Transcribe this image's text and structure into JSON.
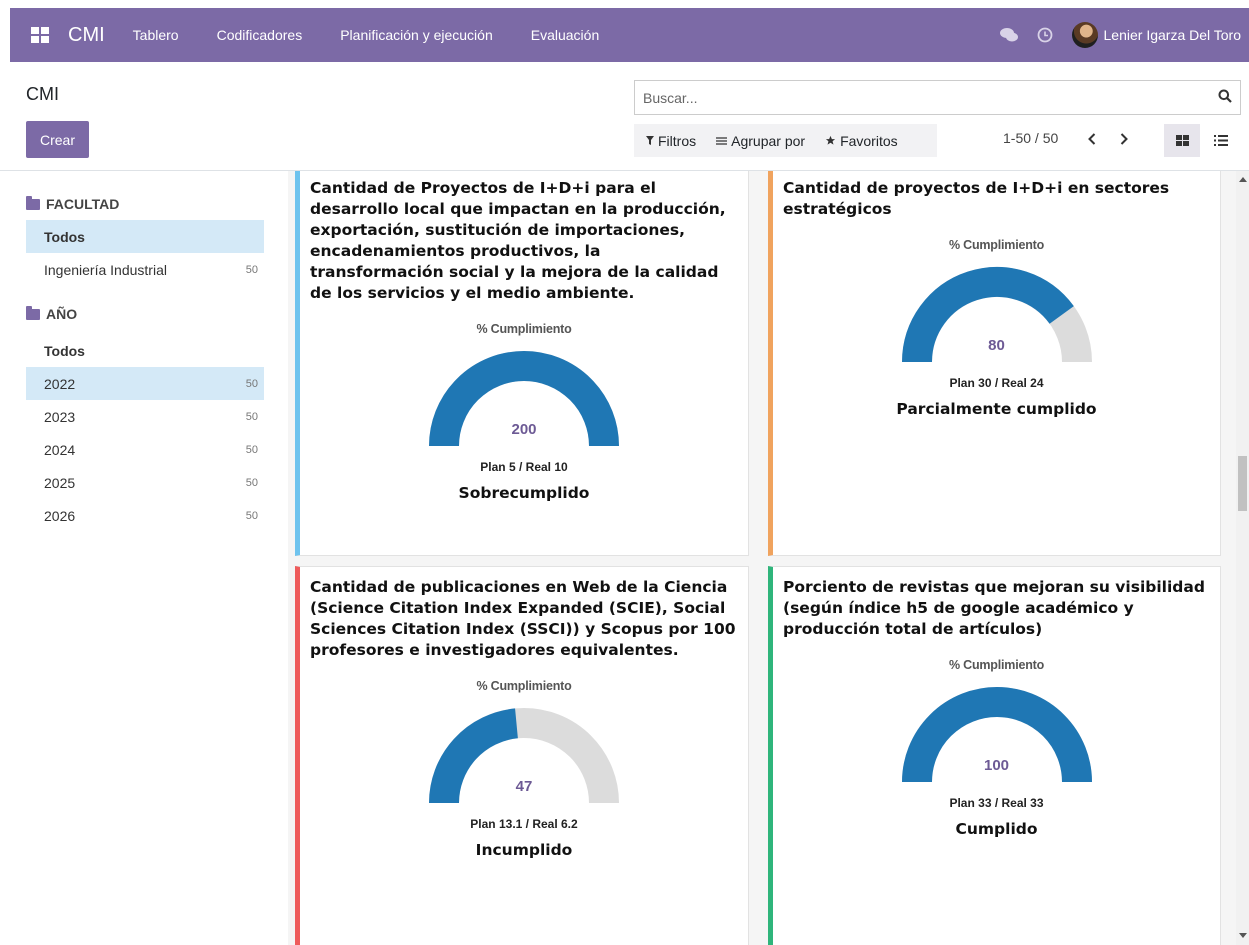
{
  "navbar": {
    "brand": "CMI",
    "menu": [
      "Tablero",
      "Codificadores",
      "Planificación y ejecución",
      "Evaluación"
    ],
    "user_name": "Lenier Igarza Del Toro",
    "color": "#7c6aa6"
  },
  "control_panel": {
    "title": "CMI",
    "create_label": "Crear",
    "search_placeholder": "Buscar...",
    "filters_label": "Filtros",
    "group_by_label": "Agrupar por",
    "favorites_label": "Favoritos",
    "pager": "1-50 / 50"
  },
  "sidebar": {
    "section1": {
      "title": "FACULTAD",
      "items": [
        {
          "label": "Todos",
          "count": ""
        },
        {
          "label": "Ingeniería Industrial",
          "count": "50"
        }
      ]
    },
    "section2": {
      "title": "AÑO",
      "items": [
        {
          "label": "Todos",
          "count": ""
        },
        {
          "label": "2022",
          "count": "50"
        },
        {
          "label": "2023",
          "count": "50"
        },
        {
          "label": "2024",
          "count": "50"
        },
        {
          "label": "2025",
          "count": "50"
        },
        {
          "label": "2026",
          "count": "50"
        }
      ]
    }
  },
  "cards": [
    {
      "title": "Cantidad de Proyectos de I+D+i para el desarrollo local que impactan en la producción, exportación, sustitución de importaciones, encadenamientos productivos, la transformación social y la mejora de la calidad de los servicios y el medio ambiente.",
      "gauge_label": "% Cumplimiento",
      "value": "200",
      "fill_fraction": 1.0,
      "plan_real": "Plan 5 / Real 10",
      "status": "Sobrecumplido",
      "accent": "#6ec3ee"
    },
    {
      "title": "Cantidad de proyectos de I+D+i en sectores estratégicos",
      "gauge_label": "% Cumplimiento",
      "value": "80",
      "fill_fraction": 0.8,
      "plan_real": "Plan 30 / Real 24",
      "status": "Parcialmente cumplido",
      "accent": "#f0a35e"
    },
    {
      "title": "Cantidad de publicaciones en Web de la Ciencia (Science Citation Index Expanded (SCIE), Social Sciences Citation Index (SSCI)) y Scopus por 100 profesores e investigadores equivalentes.",
      "gauge_label": "% Cumplimiento",
      "value": "47",
      "fill_fraction": 0.47,
      "plan_real": "Plan 13.1 / Real 6.2",
      "status": "Incumplido",
      "accent": "#ee5b5b"
    },
    {
      "title": "Porciento de revistas que mejoran su visibilidad (según índice h5 de google académico y producción total de artículos)",
      "gauge_label": "% Cumplimiento",
      "value": "100",
      "fill_fraction": 1.0,
      "plan_real": "Plan 33 / Real 33",
      "status": "Cumplido",
      "accent": "#2fb57b"
    }
  ],
  "gauge_colors": {
    "fill": "#1f77b4",
    "track": "#dcdcdc"
  }
}
